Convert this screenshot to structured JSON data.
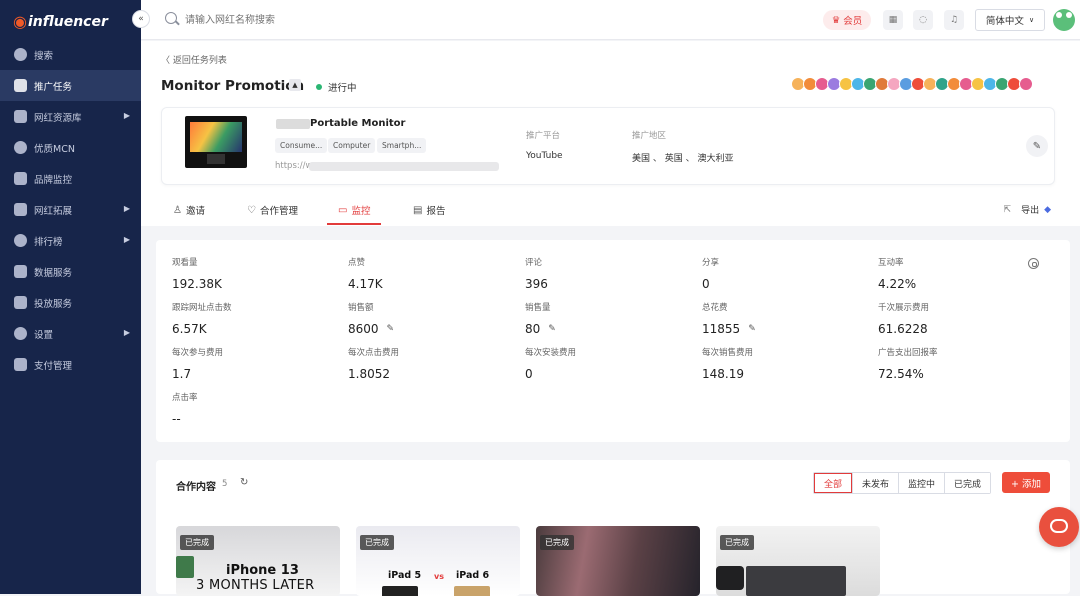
{
  "app": {
    "logo_text": "influencer"
  },
  "sidebar": {
    "items": [
      {
        "label": "搜索",
        "icon": "compass-icon",
        "active": false,
        "has_arrow": false
      },
      {
        "label": "推广任务",
        "icon": "document-icon",
        "active": true,
        "has_arrow": false
      },
      {
        "label": "网红资源库",
        "icon": "heart-icon",
        "active": false,
        "has_arrow": true
      },
      {
        "label": "优质MCN",
        "icon": "building-icon",
        "active": false,
        "has_arrow": false
      },
      {
        "label": "品牌监控",
        "icon": "shield-icon",
        "active": false,
        "has_arrow": false
      },
      {
        "label": "网红拓展",
        "icon": "mail-icon",
        "active": false,
        "has_arrow": true
      },
      {
        "label": "排行榜",
        "icon": "bar-chart-icon",
        "active": false,
        "has_arrow": true
      },
      {
        "label": "数据服务",
        "icon": "data-icon",
        "active": false,
        "has_arrow": false
      },
      {
        "label": "投放服务",
        "icon": "target-icon",
        "active": false,
        "has_arrow": false
      },
      {
        "label": "设置",
        "icon": "gear-icon",
        "active": false,
        "has_arrow": true
      },
      {
        "label": "支付管理",
        "icon": "wallet-icon",
        "active": false,
        "has_arrow": false
      }
    ]
  },
  "topbar": {
    "search_placeholder": "请输入网红名称搜索",
    "vip_label": "会员",
    "language": "简体中文"
  },
  "task": {
    "back_label": "返回任务列表",
    "title": "Monitor Promotion",
    "status": "进行中",
    "avatar_colors": [
      "#f6b25a",
      "#f28c3a",
      "#e65c8f",
      "#9b7be0",
      "#f6c344",
      "#4db6e8",
      "#3aa572",
      "#e07a3a",
      "#f5a6c0",
      "#5b9de0",
      "#ee4d3a",
      "#f6b25a",
      "#2fa38a",
      "#f28c3a",
      "#e65c8f",
      "#f6c344",
      "#4db6e8",
      "#3aa572",
      "#ee4d3a",
      "#e65c8f"
    ]
  },
  "product": {
    "name": "Portable Monitor",
    "tags": [
      "Consume...",
      "Computer",
      "Smartph..."
    ],
    "url_prefix": "https://w",
    "platform_label": "推广平台",
    "platform_value": "YouTube",
    "region_label": "推广地区",
    "region_value": "美国 、 英国 、 澳大利亚"
  },
  "tabs": [
    {
      "label": "邀请",
      "icon": "user-icon"
    },
    {
      "label": "合作管理",
      "icon": "handshake-icon"
    },
    {
      "label": "监控",
      "icon": "monitor-icon"
    },
    {
      "label": "报告",
      "icon": "report-icon"
    }
  ],
  "active_tab": "监控",
  "export_label": "导出",
  "stats": [
    {
      "label": "观看量",
      "value": "192.38K",
      "editable": false
    },
    {
      "label": "点赞",
      "value": "4.17K",
      "editable": false
    },
    {
      "label": "评论",
      "value": "396",
      "editable": false
    },
    {
      "label": "分享",
      "value": "0",
      "editable": false
    },
    {
      "label": "互动率",
      "value": "4.22%",
      "editable": false
    },
    {
      "label": "跟踪网址点击数",
      "value": "6.57K",
      "editable": false
    },
    {
      "label": "销售额",
      "value": "8600",
      "editable": true
    },
    {
      "label": "销售量",
      "value": "80",
      "editable": true
    },
    {
      "label": "总花费",
      "value": "11855",
      "editable": true
    },
    {
      "label": "千次展示费用",
      "value": "61.6228",
      "editable": false
    },
    {
      "label": "每次参与费用",
      "value": "1.7",
      "editable": false
    },
    {
      "label": "每次点击费用",
      "value": "1.8052",
      "editable": false
    },
    {
      "label": "每次安装费用",
      "value": "0",
      "editable": false
    },
    {
      "label": "每次销售费用",
      "value": "148.19",
      "editable": false
    },
    {
      "label": "广告支出回报率",
      "value": "72.54%",
      "editable": false
    },
    {
      "label": "点击率",
      "value": "--",
      "editable": false
    }
  ],
  "cooperation": {
    "title": "合作内容",
    "count": "5",
    "filters": [
      "全部",
      "未发布",
      "监控中",
      "已完成"
    ],
    "active_filter": "全部",
    "add_label": "+ 添加",
    "cards": [
      {
        "badge": "已完成",
        "line1": "iPhone 13",
        "line2": "3 MONTHS LATER"
      },
      {
        "badge": "已完成",
        "left": "iPad 5",
        "vs": "vs",
        "right": "iPad 6"
      },
      {
        "badge": "已完成"
      },
      {
        "badge": "已完成"
      }
    ]
  }
}
